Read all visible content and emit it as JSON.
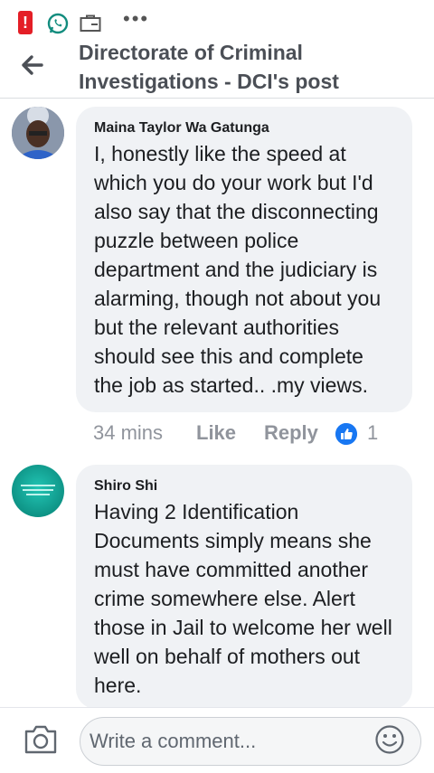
{
  "status_bar": {
    "more_label": "•••"
  },
  "header": {
    "title": "Directorate of Criminal Investigations - DCI's post"
  },
  "comments": [
    {
      "author": "Maina Taylor Wa Gatunga",
      "text": "I, honestly like the speed at which you do your work but I'd also say that the disconnecting puzzle between police department and the judiciary is alarming, though not about you but the relevant authorities should see this and complete the job as started.. .my views.",
      "time": "34 mins",
      "like_label": "Like",
      "reply_label": "Reply",
      "reaction_count": "1"
    },
    {
      "author": "Shiro Shi",
      "text": "Having 2 Identification Documents simply means she must have committed another crime somewhere else. Alert those in Jail to welcome her well well on behalf of mothers out here."
    }
  ],
  "composer": {
    "placeholder": "Write a comment..."
  },
  "colors": {
    "accent": "#1877f2",
    "bubble": "#f0f2f5",
    "alert": "#e41e26",
    "whatsapp": "#25d366"
  },
  "icons": [
    "alert-icon",
    "whatsapp-icon",
    "briefcase-icon",
    "back-arrow-icon",
    "like-reaction-icon",
    "camera-icon",
    "emoji-icon"
  ]
}
